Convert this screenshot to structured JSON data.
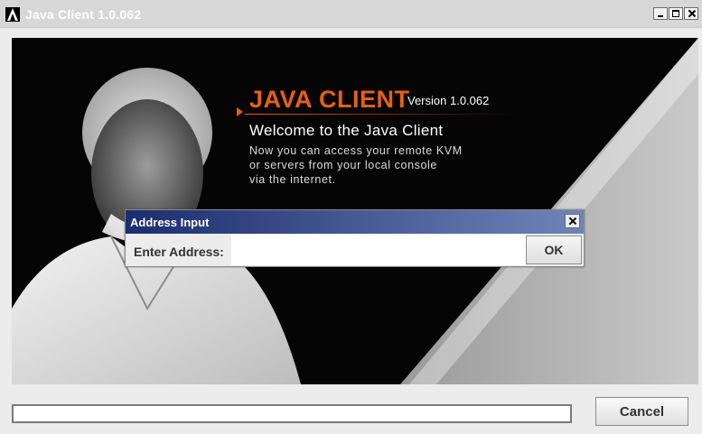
{
  "window": {
    "title": "Java Client 1.0.062",
    "logo_icon": "ansys-a-logo-icon"
  },
  "splash": {
    "brand": "JAVA CLIENT",
    "version": "Version 1.0.062",
    "welcome": "Welcome to the Java Client",
    "description": "Now you can access your remote KVM\nor servers from your local console\nvia the internet.",
    "accent_color": "#e8600e"
  },
  "dialog": {
    "title": "Address Input",
    "label": "Enter Address:",
    "input_value": "",
    "ok_label": "OK"
  },
  "footer": {
    "progress_fraction": 0,
    "cancel_label": "Cancel"
  }
}
